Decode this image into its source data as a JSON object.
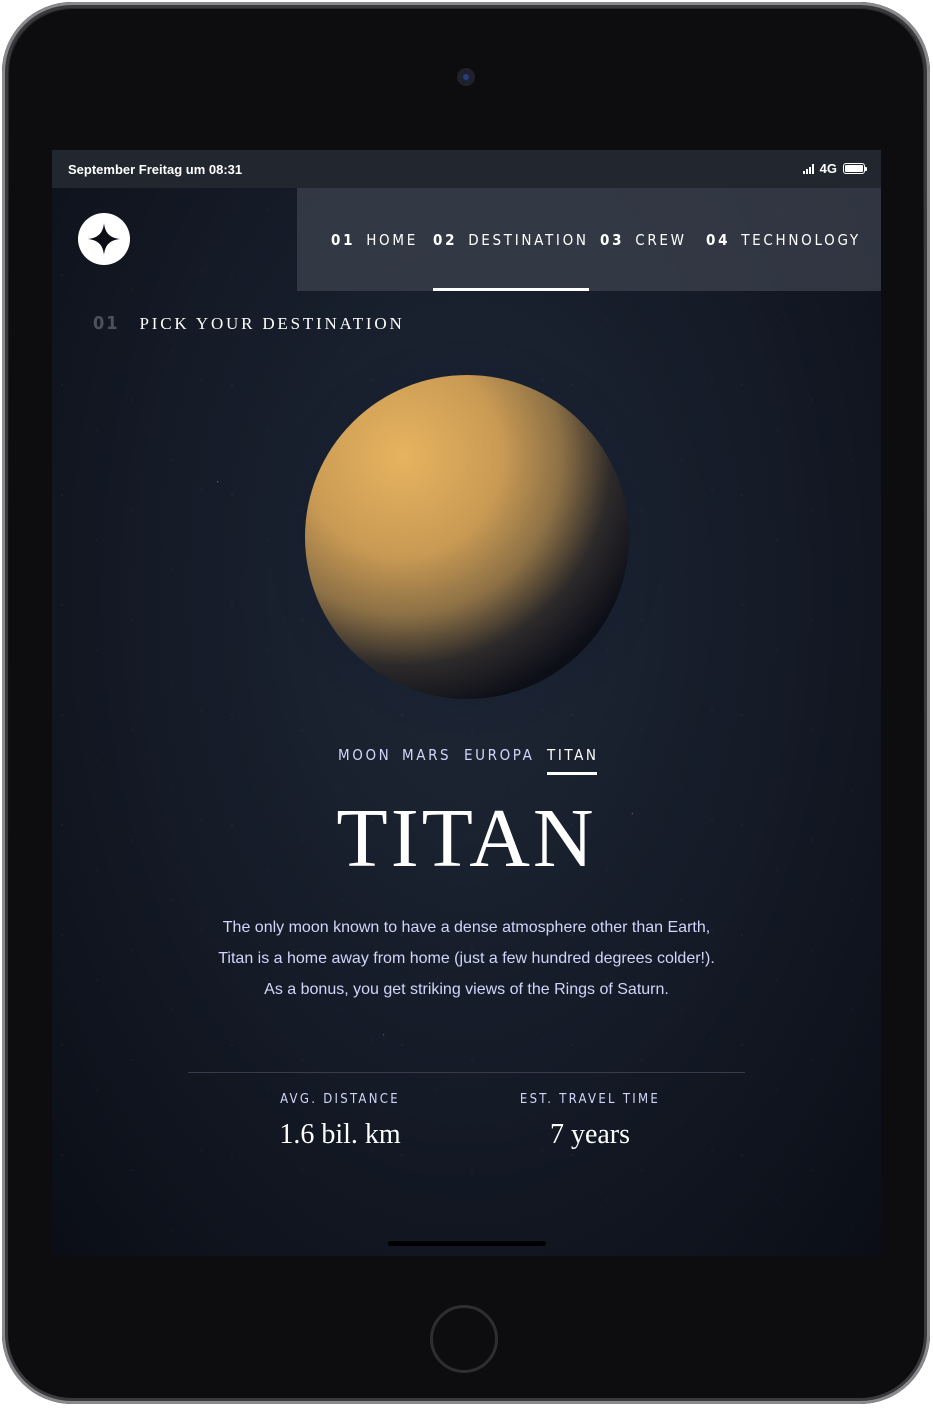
{
  "statusbar": {
    "time": "September Freitag um 08:31",
    "network": "4G",
    "signal_icon": "cellular-signal-icon",
    "battery_icon": "battery-icon"
  },
  "nav": {
    "items": [
      {
        "num": "01",
        "label": "HOME"
      },
      {
        "num": "02",
        "label": "DESTINATION"
      },
      {
        "num": "03",
        "label": "CREW"
      },
      {
        "num": "04",
        "label": "TECHNOLOGY"
      }
    ],
    "active": "DESTINATION"
  },
  "heading": {
    "num": "01",
    "text": "PICK YOUR DESTINATION"
  },
  "destination_tabs": [
    "MOON",
    "MARS",
    "EUROPA",
    "TITAN"
  ],
  "active_tab": "TITAN",
  "destination": {
    "name": "TITAN",
    "description": "The only moon known to have a dense atmosphere other than Earth, Titan is a home away from home (just a few hundred degrees colder!). As a bonus, you get striking views of the Rings of Saturn.",
    "stats": [
      {
        "label": "AVG. DISTANCE",
        "value": "1.6 bil. km"
      },
      {
        "label": "EST. TRAVEL TIME",
        "value": "7 years"
      }
    ]
  },
  "colors": {
    "accent": "#ffffff",
    "muted_text": "#d0d6f9",
    "background": "#0b0d17",
    "planet": "#c99a54"
  }
}
